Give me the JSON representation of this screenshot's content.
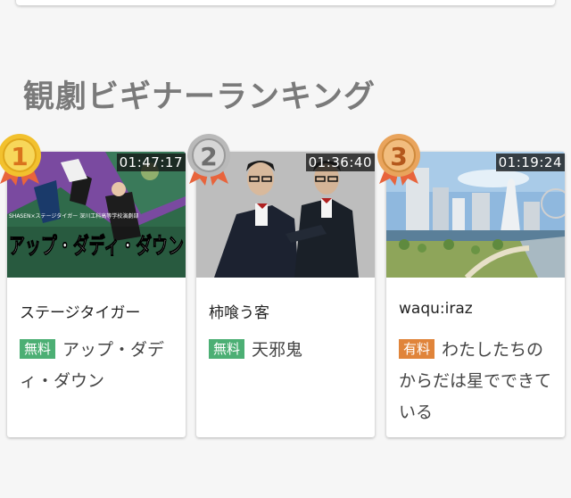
{
  "section": {
    "title": "観劇ビギナーランキング"
  },
  "colors": {
    "free_badge": "#4caf74",
    "paid_badge": "#e0843a",
    "medal_gold": "#f2c12e",
    "medal_silver": "#b9b9b9",
    "medal_bronze": "#e9a45c",
    "ribbon": "#e8643c"
  },
  "ranking": [
    {
      "rank": "1",
      "duration": "01:47:17",
      "author": "ステージタイガー",
      "price": "無料",
      "title": "アップ・ダディ・ダウン",
      "thumb_caption": "アップ・ダディ・ダウン",
      "thumb_subcaption": "SHASEN×ステージタイガー 深川工科高等学校演劇部"
    },
    {
      "rank": "2",
      "duration": "01:36:40",
      "author": "柿喰う客",
      "price": "無料",
      "title": "天邪鬼"
    },
    {
      "rank": "3",
      "duration": "01:19:24",
      "author": "waqu:iraz",
      "price": "有料",
      "title": "わたしたちのからだは星でできている"
    }
  ]
}
